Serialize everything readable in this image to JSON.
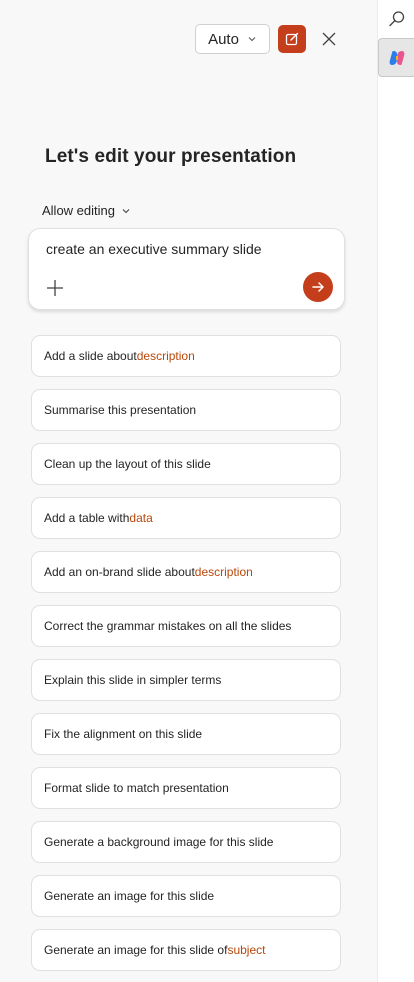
{
  "header": {
    "mode_label": "Auto"
  },
  "main": {
    "title": "Let's edit your presentation",
    "allow_editing_label": "Allow editing",
    "composer_text": "create an executive summary slide"
  },
  "suggestions": [
    {
      "text": "Add a slide about ",
      "highlight": "description"
    },
    {
      "text": "Summarise this presentation",
      "highlight": ""
    },
    {
      "text": "Clean up the layout of this slide",
      "highlight": ""
    },
    {
      "text": "Add a table with ",
      "highlight": "data"
    },
    {
      "text": "Add an on-brand slide about ",
      "highlight": "description"
    },
    {
      "text": "Correct the grammar mistakes on all the slides",
      "highlight": ""
    },
    {
      "text": "Explain this slide in simpler terms",
      "highlight": ""
    },
    {
      "text": "Fix the alignment on this slide",
      "highlight": ""
    },
    {
      "text": "Format slide to match presentation",
      "highlight": ""
    },
    {
      "text": "Generate a background image for this slide",
      "highlight": ""
    },
    {
      "text": "Generate an image for this slide",
      "highlight": ""
    },
    {
      "text": "Generate an image for this slide of ",
      "highlight": "subject"
    }
  ],
  "colors": {
    "accent": "#c43e1c",
    "highlight_text": "#b8470a",
    "panel_bg": "#f8f8f8"
  },
  "icons": {
    "rail_search": "search-icon",
    "rail_copilot": "copilot-icon",
    "edit": "compose-icon",
    "close": "close-icon",
    "chevron": "chevron-down-icon",
    "attach": "plus-icon",
    "send": "arrow-right-icon"
  }
}
